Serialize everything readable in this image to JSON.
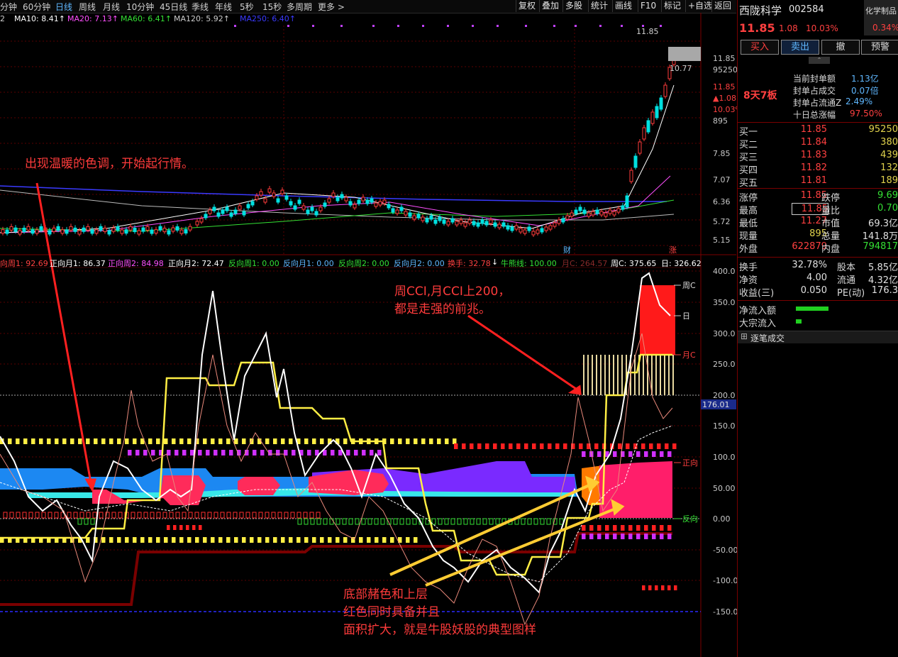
{
  "toolbar": {
    "periods": [
      "分钟",
      "60分钟",
      "日线",
      "周线",
      "月线",
      "10分钟",
      "45日线",
      "季线",
      "年线",
      "5秒",
      "15秒",
      "多周期",
      "更多 >"
    ],
    "active_period": "日线",
    "right_buttons": [
      "复权",
      "叠加",
      "多股",
      "统计",
      "画线",
      "F10",
      "标记",
      "+自选",
      "返回"
    ]
  },
  "ma_labels": [
    {
      "text": "2",
      "color": "#cccccc"
    },
    {
      "text": "MA10: 8.41↑",
      "color": "#ffffff"
    },
    {
      "text": "MA20: 7.13↑",
      "color": "#ff4fff"
    },
    {
      "text": "MA60: 6.41↑",
      "color": "#34e034"
    },
    {
      "text": "MA120: 5.92↑",
      "color": "#cccccc"
    },
    {
      "text": "MA250: 6.40↑",
      "color": "#3a3aff"
    }
  ],
  "price_axis": [
    "11.85",
    "95250",
    "11.85",
    "▲1.08",
    "10.03%",
    "895",
    "7.85",
    "7.07",
    "6.36",
    "5.72",
    "5.15"
  ],
  "price_tags": {
    "high": "11.85",
    "low_tag": "10.77",
    "event1": "财",
    "event2": "涨"
  },
  "indicator_labels": [
    {
      "text": "向周1: 92.69",
      "color": "#ff4040"
    },
    {
      "text": "正向月1: 86.37",
      "color": "#ffffff"
    },
    {
      "text": "正向周2: 84.98",
      "color": "#ff4fff"
    },
    {
      "text": "正向月2: 72.47",
      "color": "#ffffff"
    },
    {
      "text": "反向周1: 0.00",
      "color": "#34e034"
    },
    {
      "text": "反向月1: 0.00",
      "color": "#5fb7ff"
    },
    {
      "text": "反向周2: 0.00",
      "color": "#34e034"
    },
    {
      "text": "反向月2: 0.00",
      "color": "#5fb7ff"
    },
    {
      "text": "换手: 32.78",
      "color": "#ff4040"
    },
    {
      "text": "↓",
      "color": "#ffffff"
    },
    {
      "text": "牛熊线: 100.00",
      "color": "#34e034"
    },
    {
      "text": "月C: 264.57",
      "color": "#8a2a2a"
    },
    {
      "text": "周C: 375.65",
      "color": "#ffffff"
    },
    {
      "text": "日: 326.62",
      "color": "#ffffff"
    }
  ],
  "cci_axis": [
    "400.0",
    "350.0",
    "300.0",
    "250.0",
    "200.0",
    "150.0",
    "100.0",
    "50.00",
    "0.00",
    "-50.00",
    "-100.0",
    "-150.0"
  ],
  "cci_tags": {
    "value": "176.01",
    "week": "周C",
    "day": "日",
    "month": "月C",
    "pos": "正向",
    "neg": "反向"
  },
  "annotations": {
    "a1": "出现温暖的色调，开始起行情。",
    "a2_line1": "周CCI,月CCI上200，",
    "a2_line2": "都是走强的前兆。",
    "a3_line1": "底部赭色和上层",
    "a3_line2": "红色同时具备并且",
    "a3_line3": "面积扩大，就是牛股妖股的典型图样"
  },
  "stock": {
    "name": "西陇科学",
    "code": "002584",
    "sector": "化学制品",
    "sector_change": "0.34%",
    "price": "11.85",
    "change": "1.08",
    "pct": "10.03%",
    "buttons": [
      "买入",
      "卖出",
      "撤",
      "预警"
    ],
    "streak": "8天7板",
    "seal": [
      {
        "label": "当前封单额",
        "value": "1.13亿"
      },
      {
        "label": "封单占成交",
        "value": "0.07倍"
      },
      {
        "label": "封单占流通Z",
        "value": "2.49%"
      },
      {
        "label": "十日总涨幅",
        "value": "97.50%"
      }
    ],
    "bids": [
      {
        "label": "买一",
        "price": "11.85",
        "vol": "95250"
      },
      {
        "label": "买二",
        "price": "11.84",
        "vol": "380"
      },
      {
        "label": "买三",
        "price": "11.83",
        "vol": "439"
      },
      {
        "label": "买四",
        "price": "11.82",
        "vol": "132"
      },
      {
        "label": "买五",
        "price": "11.81",
        "vol": "189"
      }
    ],
    "stats": [
      {
        "l1": "涨停",
        "v1": "11.85",
        "l2": "跌停",
        "v2": "9.69"
      },
      {
        "l1": "最高",
        "v1": "11.85",
        "l2": "量比",
        "v2": "0.70"
      },
      {
        "l1": "最低",
        "v1": "11.27",
        "l2": "市值",
        "v2": "69.3亿"
      },
      {
        "l1": "现量",
        "v1": "895",
        "l2": "总量",
        "v2": "141.8万"
      },
      {
        "l1": "外盘",
        "v1": "622879",
        "l2": "内盘",
        "v2": "794817"
      }
    ],
    "stats2": [
      {
        "l1": "换手",
        "v1": "32.78%",
        "l2": "股本",
        "v2": "5.85亿"
      },
      {
        "l1": "净资",
        "v1": "4.00",
        "l2": "流通",
        "v2": "4.32亿"
      },
      {
        "l1": "收益(三)",
        "v1": "0.050",
        "l2": "PE(动)",
        "v2": "176.3"
      }
    ],
    "flows": [
      {
        "label": "净流入额"
      },
      {
        "label": "大宗流入"
      }
    ],
    "tick_title": "逐笔成交"
  }
}
